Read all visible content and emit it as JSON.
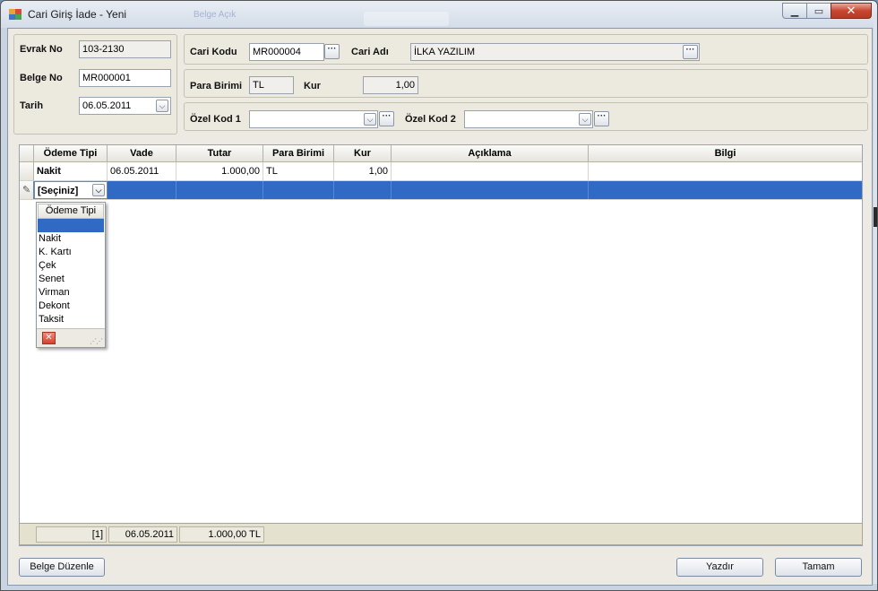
{
  "window": {
    "title": "Cari Giriş İade - Yeni",
    "bg_ghost_text": "Belge Açık"
  },
  "header": {
    "evrak_no": {
      "label": "Evrak No",
      "value": "103-2130"
    },
    "belge_no": {
      "label": "Belge No",
      "value": "MR000001"
    },
    "tarih": {
      "label": "Tarih",
      "value": "06.05.2011"
    },
    "cari_kodu": {
      "label": "Cari Kodu",
      "value": "MR000004"
    },
    "cari_adi": {
      "label": "Cari Adı",
      "value": "İLKA YAZILIM"
    },
    "para_birimi": {
      "label": "Para Birimi",
      "value": "TL"
    },
    "kur": {
      "label": "Kur",
      "value": "1,00"
    },
    "ozel_kod_1": {
      "label": "Özel Kod 1",
      "value": ""
    },
    "ozel_kod_2": {
      "label": "Özel Kod 2",
      "value": ""
    }
  },
  "grid": {
    "columns": [
      "Ödeme Tipi",
      "Vade",
      "Tutar",
      "Para Birimi",
      "Kur",
      "Açıklama",
      "Bilgi"
    ],
    "rows": [
      {
        "odeme_tipi": "Nakit",
        "vade": "06.05.2011",
        "tutar": "1.000,00",
        "para_birimi": "TL",
        "kur": "1,00",
        "aciklama": "",
        "bilgi": ""
      }
    ],
    "edit_row": {
      "odeme_tipi": "[Seçiniz]"
    },
    "colors": {
      "selection": "#316ac5"
    }
  },
  "dropdown": {
    "header": "Ödeme Tipi",
    "items": [
      "Nakit",
      "K. Kartı",
      "Çek",
      "Senet",
      "Virman",
      "Dekont",
      "Taksit"
    ]
  },
  "summary": {
    "count": "[1]",
    "vade": "06.05.2011",
    "tutar": "1.000,00 TL"
  },
  "buttons": {
    "belge_duzenle": "Belge Düzenle",
    "yazdir": "Yazdır",
    "tamam": "Tamam"
  }
}
